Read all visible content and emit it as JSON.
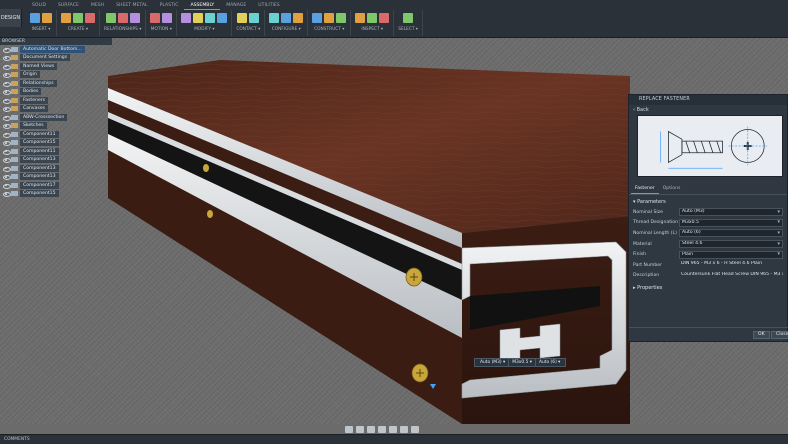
{
  "toolbar": {
    "workspace": "DESIGN",
    "tabs": [
      {
        "label": "SOLID",
        "active": false
      },
      {
        "label": "SURFACE",
        "active": false
      },
      {
        "label": "MESH",
        "active": false
      },
      {
        "label": "SHEET METAL",
        "active": false
      },
      {
        "label": "PLASTIC",
        "active": false
      },
      {
        "label": "ASSEMBLY",
        "active": true
      },
      {
        "label": "MANAGE",
        "active": false
      },
      {
        "label": "UTILITIES",
        "active": false
      }
    ],
    "groups": [
      {
        "label": "INSERT ▾",
        "icons": [
          "insert-component-icon",
          "insert-derive-icon"
        ]
      },
      {
        "label": "CREATE ▾",
        "icons": [
          "new-component-icon",
          "extrude-icon",
          "revolve-icon"
        ]
      },
      {
        "label": "RELATIONSHIPS ▾",
        "icons": [
          "joint-icon",
          "as-built-joint-icon",
          "rigid-group-icon"
        ]
      },
      {
        "label": "MOTION ▾",
        "icons": [
          "drive-joints-icon",
          "motion-link-icon"
        ]
      },
      {
        "label": "MODIFY ▾",
        "icons": [
          "move-icon",
          "parameters-icon",
          "appearance-icon",
          "delete-icon"
        ]
      },
      {
        "label": "CONTACT ▾",
        "icons": [
          "contact-sets-icon",
          "enable-contact-icon"
        ]
      },
      {
        "label": "CONFIGURE ▾",
        "icons": [
          "configuration-icon",
          "table-icon",
          "theme-icon"
        ]
      },
      {
        "label": "CONSTRUCT ▾",
        "icons": [
          "offset-plane-icon",
          "axis-icon",
          "point-icon"
        ]
      },
      {
        "label": "INSPECT ▾",
        "icons": [
          "measure-icon",
          "interference-icon",
          "section-analysis-icon"
        ]
      },
      {
        "label": "SELECT ▾",
        "icons": [
          "select-icon"
        ]
      }
    ]
  },
  "browser": {
    "header": "BROWSER",
    "items": [
      {
        "label": "Automatic Door Bottom...",
        "icon": "component-icon",
        "root": true
      },
      {
        "label": "Document Settings",
        "icon": "folder-icon"
      },
      {
        "label": "Named Views",
        "icon": "folder-icon"
      },
      {
        "label": "Origin",
        "icon": "folder-icon"
      },
      {
        "label": "Relationships",
        "icon": "folder-icon"
      },
      {
        "label": "Bodies",
        "icon": "folder-icon"
      },
      {
        "label": "Fasteners",
        "icon": "folder-icon"
      },
      {
        "label": "Canvases",
        "icon": "folder-icon"
      },
      {
        "label": "ABW-Crosssection",
        "icon": "canvas-icon"
      },
      {
        "label": "Sketches",
        "icon": "folder-icon"
      },
      {
        "label": "Component11",
        "icon": "component-icon"
      },
      {
        "label": "Component15",
        "icon": "component-icon"
      },
      {
        "label": "Component11",
        "icon": "component-icon"
      },
      {
        "label": "Component13",
        "icon": "component-icon"
      },
      {
        "label": "Component13",
        "icon": "component-icon"
      },
      {
        "label": "Component13",
        "icon": "component-icon"
      },
      {
        "label": "Component17",
        "icon": "component-icon"
      },
      {
        "label": "Component15",
        "icon": "component-icon"
      }
    ]
  },
  "panel": {
    "title": "REPLACE FASTENER",
    "back_label": "Back",
    "tabs": [
      {
        "label": "Fastener",
        "active": true
      },
      {
        "label": "Options",
        "active": false
      }
    ],
    "parameters_label": "Parameters",
    "fields": [
      {
        "label": "Nominal Size",
        "value": "Auto (M3)",
        "type": "dropdown"
      },
      {
        "label": "Thread Designation",
        "value": "M3x0.5",
        "type": "dropdown"
      },
      {
        "label": "Nominal Length (L)",
        "value": "Auto (6)",
        "type": "dropdown"
      },
      {
        "label": "Material",
        "value": "Steel 4.6",
        "type": "dropdown"
      },
      {
        "label": "Finish",
        "value": "Plain",
        "type": "dropdown"
      },
      {
        "label": "Part Number",
        "value": "DIN 965 - M3 x 6 - H Steel 4.6 Plain",
        "type": "text"
      },
      {
        "label": "Description",
        "value": "Countersunk Flat Head Screw DIN 965 - M3 x 6 - H",
        "type": "text"
      }
    ],
    "properties_label": "Properties",
    "ok_label": "OK",
    "close_label": "Close"
  },
  "canvas_dropdown": [
    "Auto (M3) ▾",
    "M3x0.5 ▾",
    "Auto (6) ▾"
  ],
  "timeline": {
    "label": "COMMENTS"
  },
  "colors": {
    "accent": "#4da3ff",
    "panel_bg": "#2f3741",
    "toolbar_bg": "#2b3138",
    "wood": "#5a2d1f",
    "aluminum": "#e4e6e8"
  }
}
